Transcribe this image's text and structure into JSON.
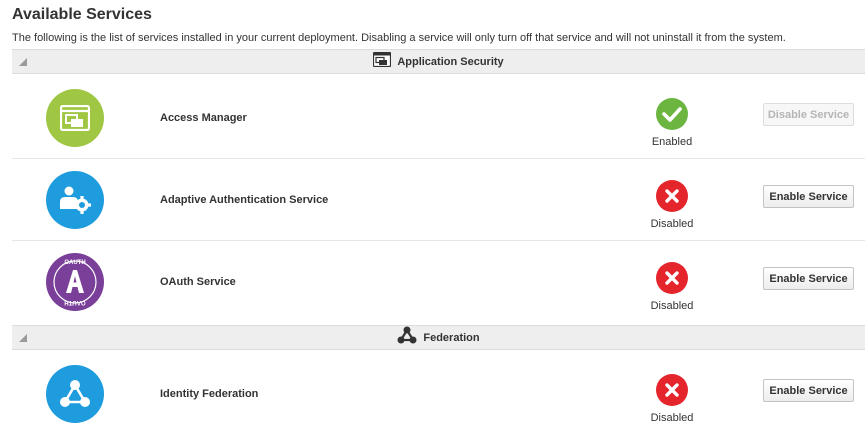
{
  "page": {
    "title": "Available Services",
    "description": "The following is the list of services installed in your current deployment. Disabling a service will only turn off that service and will not uninstall it from the system."
  },
  "colors": {
    "enabled": "#6cb541",
    "disabled": "#e4252c",
    "access_manager_icon": "#9fc743",
    "adaptive_auth_icon": "#1e9cdd",
    "oauth_icon": "#7a3f98",
    "federation_icon": "#1e9cdd"
  },
  "sections": [
    {
      "title": "Application Security",
      "icon": "window-icon",
      "services": [
        {
          "name": "Access Manager",
          "icon": "access-manager-icon",
          "status": "Enabled",
          "button_label": "Disable Service",
          "button_enabled": false
        },
        {
          "name": "Adaptive Authentication Service",
          "icon": "adaptive-auth-icon",
          "status": "Disabled",
          "button_label": "Enable Service",
          "button_enabled": true
        },
        {
          "name": "OAuth Service",
          "icon": "oauth-icon",
          "icon_text_top": "OAUTH",
          "icon_text_bottom": "OAUTH",
          "status": "Disabled",
          "button_label": "Enable Service",
          "button_enabled": true
        }
      ]
    },
    {
      "title": "Federation",
      "icon": "federation-icon",
      "services": [
        {
          "name": "Identity Federation",
          "icon": "identity-federation-icon",
          "status": "Disabled",
          "button_label": "Enable Service",
          "button_enabled": true
        }
      ]
    }
  ]
}
